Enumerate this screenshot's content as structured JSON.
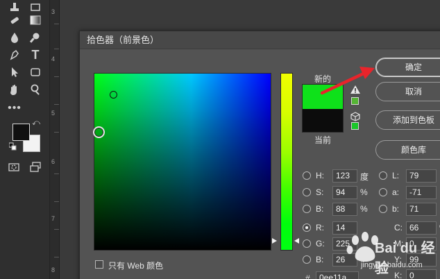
{
  "dialog": {
    "title": "拾色器（前景色）",
    "label_new": "新的",
    "label_current": "当前",
    "new_color": "#0ee11a",
    "current_color": "#0c0c0c"
  },
  "buttons": {
    "ok": "确定",
    "cancel": "取消",
    "add_to_swatches": "添加到色板",
    "color_libraries": "颜色库"
  },
  "hsb": {
    "h_label": "H:",
    "h_value": "123",
    "h_unit": "度",
    "s_label": "S:",
    "s_value": "94",
    "s_unit": "%",
    "b_label": "B:",
    "b_value": "88",
    "b_unit": "%"
  },
  "lab": {
    "l_label": "L:",
    "l_value": "79",
    "a_label": "a:",
    "a_value": "-71",
    "b_label": "b:",
    "b_value": "71"
  },
  "rgb": {
    "r_label": "R:",
    "r_value": "14",
    "g_label": "G:",
    "g_value": "225",
    "b_label": "B:",
    "b_value": "26",
    "selected": "R"
  },
  "cmyk": {
    "c_label": "C:",
    "c_value": "66",
    "c_unit": "%",
    "m_label": "M:",
    "m_value": "0",
    "y_label": "Y:",
    "y_value": "99",
    "k_label": "K:",
    "k_value": "0"
  },
  "hex": {
    "label": "#",
    "value": "0ee11a"
  },
  "web_only": {
    "label": "只有 Web 颜色",
    "checked": false
  },
  "ruler": {
    "ticks": [
      "3",
      "4",
      "5",
      "6",
      "7",
      "8"
    ]
  },
  "toolbar": {
    "fg_color": "#101010",
    "bg_color": "#f3f3f3",
    "tools": [
      "stamp-tool-icon",
      "rectangle-tool-icon",
      "healing-brush-icon",
      "gradient-tool-icon",
      "blur-tool-icon",
      "dodge-tool-icon",
      "pen-tool-icon",
      "type-tool-icon",
      "selection-tool-icon",
      "shape-tool-icon",
      "hand-tool-icon",
      "zoom-tool-icon",
      "more-tools-icon"
    ]
  },
  "watermark": {
    "brand": "Bai du 经验",
    "url": "jingyan.baidu.com"
  }
}
